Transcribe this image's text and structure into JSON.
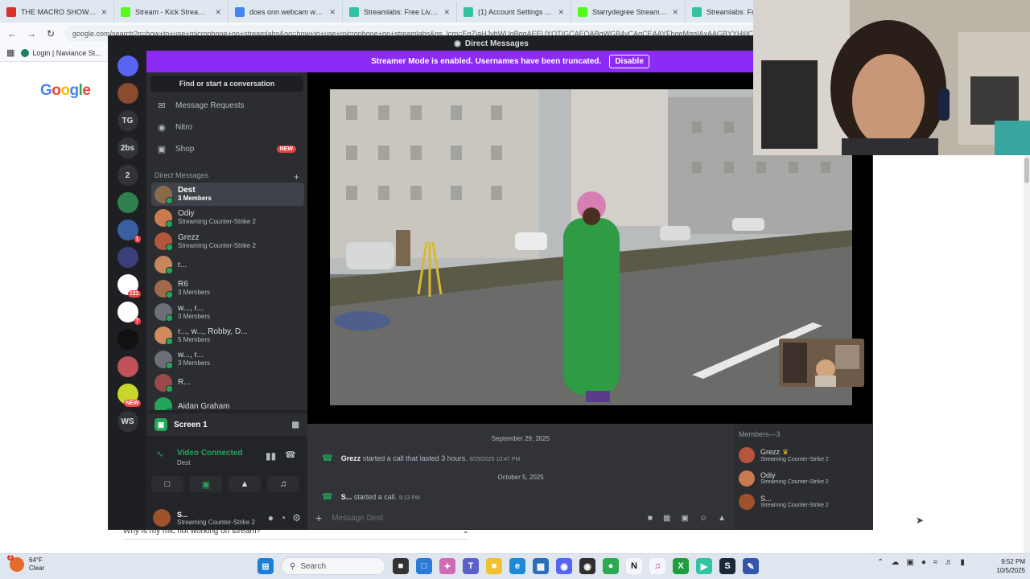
{
  "browser": {
    "tabs": [
      {
        "label": "THE MACRO SHOW: Septe",
        "icon": "gmail-icon",
        "color": "#d93025"
      },
      {
        "label": "Stream - Kick Streaming",
        "icon": "kick-icon",
        "color": "#53fc18"
      },
      {
        "label": "does onn webcam work w",
        "icon": "google-icon",
        "color": "#4285f4"
      },
      {
        "label": "Streamlabs: Free Live Strea",
        "icon": "streamlabs-icon",
        "color": "#31c3a2"
      },
      {
        "label": "(1) Account Settings / Stre",
        "icon": "streamlabs-icon",
        "color": "#31c3a2"
      },
      {
        "label": "Starrydegree Stream - Wa",
        "icon": "kick-icon",
        "color": "#53fc18"
      },
      {
        "label": "Streamlabs: Free",
        "icon": "streamlabs-icon",
        "color": "#31c3a2"
      }
    ],
    "url": "google.com/search?q=how+to+use+microphone+on+streamlabs&oq=how+to+use+microphone+on+streamlabs&gs_lcrp=EgZjaHJvbWUqBggAEEUYOTIGCAEQABgWGB4yCAgCEAAYFhgeMggIAxAAGBYYHjIICAQQABgWGB4yCAgFEAAYFhge",
    "bookmark": "Login | Naviance St...",
    "google_logo": [
      "G",
      "o",
      "o",
      "g",
      "l",
      "e"
    ],
    "faq_question": "Why is my mic not working on stream?"
  },
  "discord": {
    "window_title": "Direct Messages",
    "streamer_banner": "Streamer Mode is enabled. Usernames have been truncated.",
    "disable_label": "Disable",
    "guilds": [
      {
        "label": "",
        "icon": "discord-icon",
        "color": "#5865f2"
      },
      {
        "label": "",
        "icon": "avatar-icon",
        "color": "#8a4b2f"
      },
      {
        "label": "TG",
        "icon": "",
        "color": "#313338"
      },
      {
        "label": "2bs",
        "icon": "",
        "color": "#313338"
      },
      {
        "label": "2",
        "icon": "",
        "color": "#313338"
      },
      {
        "label": "",
        "icon": "globe-icon",
        "color": "#2f7f4f"
      },
      {
        "label": "",
        "icon": "server-icon",
        "color": "#3a5fa0",
        "badge": "1"
      },
      {
        "label": "",
        "icon": "server-icon",
        "color": "#3b3f7a"
      },
      {
        "label": "",
        "icon": "server-icon",
        "color": "#ffffff",
        "badge": "121"
      },
      {
        "label": "",
        "icon": "server-icon",
        "color": "#ffffff",
        "badge": "7"
      },
      {
        "label": "",
        "icon": "server-icon",
        "color": "#111111"
      },
      {
        "label": "",
        "icon": "server-icon",
        "color": "#c0505a"
      },
      {
        "label": "",
        "icon": "server-icon",
        "color": "#c8d62c",
        "badge": "NEW"
      },
      {
        "label": "WS",
        "icon": "",
        "color": "#313338"
      }
    ],
    "find_conversation": "Find or start a conversation",
    "nav": [
      {
        "label": "Message Requests",
        "icon": "envelope-icon"
      },
      {
        "label": "Nitro",
        "icon": "nitro-icon"
      },
      {
        "label": "Shop",
        "icon": "shop-icon",
        "badge": "NEW"
      }
    ],
    "dm_header": "Direct Messages",
    "dm_add": "+",
    "dms": [
      {
        "name": "Dest",
        "sub": "3 Members",
        "color": "#8b6a4a",
        "active": true
      },
      {
        "name": "Odiy",
        "sub": "Streaming Counter-Strike 2",
        "color": "#c77b4e"
      },
      {
        "name": "Grezz",
        "sub": "Streaming Counter-Strike 2",
        "color": "#b5563c"
      },
      {
        "name": "r...",
        "sub": "",
        "color": "#c8875a"
      },
      {
        "name": "R6",
        "sub": "3 Members",
        "color": "#a06a4a"
      },
      {
        "name": "w..., r...",
        "sub": "3 Members",
        "color": "#6c6f78"
      },
      {
        "name": "r..., w..., Robby, D...",
        "sub": "5 Members",
        "color": "#d08a5c"
      },
      {
        "name": "w..., r...",
        "sub": "3 Members",
        "color": "#6c6f78"
      },
      {
        "name": "R...",
        "sub": "",
        "color": "#9a4a4a"
      },
      {
        "name": "Aidan Graham",
        "sub": "",
        "color": "#23a55a"
      }
    ],
    "voice": {
      "screen_label": "Screen 1",
      "status": "Video Connected",
      "channel": "Dest"
    },
    "user": {
      "name": "S...",
      "status": "Streaming Counter-Strike 2"
    },
    "chat": {
      "dates": [
        "September 29, 2025",
        "October 5, 2025"
      ],
      "calls": [
        {
          "user": "Grezz",
          "text": "started a call that lasted 3 hours.",
          "time": "9/29/2025 10:47 PM"
        },
        {
          "user": "S...",
          "text": "started a call.",
          "time": "9:13 PM"
        }
      ],
      "placeholder": "Message Dest"
    },
    "members": {
      "header": "Members—3",
      "list": [
        {
          "name": "Grezz",
          "crown": "♛",
          "status": "Streaming Counter-Strike 2",
          "color": "#b5563c"
        },
        {
          "name": "Odiy",
          "status": "Streaming Counter-Strike 2",
          "color": "#c77b4e"
        },
        {
          "name": "S...",
          "status": "Streaming Counter-Strike 2",
          "color": "#a0522d"
        }
      ]
    }
  },
  "taskbar": {
    "weather_temp": "64°F",
    "weather_desc": "Clear",
    "weather_badge": "3",
    "search_label": "Search",
    "time": "9:52 PM",
    "date": "10/5/2025"
  }
}
